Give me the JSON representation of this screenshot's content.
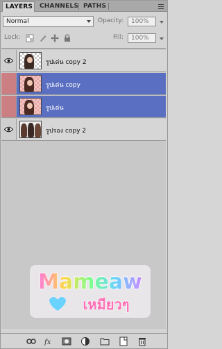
{
  "tabs": [
    {
      "label": "LAYERS",
      "active": true
    },
    {
      "label": "CHANNELS",
      "active": false
    },
    {
      "label": "PATHS",
      "active": false
    }
  ],
  "blend": {
    "mode": "Normal",
    "opacity_label": "Opacity:",
    "opacity_value": "100%"
  },
  "lock": {
    "label": "Lock:",
    "fill_label": "Fill:",
    "fill_value": "100%"
  },
  "layers": [
    {
      "name": "รูปเด่น copy 2",
      "visible": true,
      "selected": false
    },
    {
      "name": "รูปเด่น copy",
      "visible": false,
      "selected": true
    },
    {
      "name": "รูปเด่น",
      "visible": false,
      "selected": true
    },
    {
      "name": "รูปรอง copy 2",
      "visible": true,
      "selected": false
    }
  ],
  "watermark": {
    "line1": "Mameaw",
    "line2": "เหมียวๆ"
  },
  "colors": {
    "selected_row": "#5b6fc2",
    "selected_eye_cell": "#cc7f82",
    "panel_bg": "#d4d4d4"
  },
  "toolbar_icons": [
    "link-layers-icon",
    "fx-icon",
    "add-mask-icon",
    "adjustment-layer-icon",
    "new-group-icon",
    "new-layer-icon",
    "delete-layer-icon"
  ]
}
